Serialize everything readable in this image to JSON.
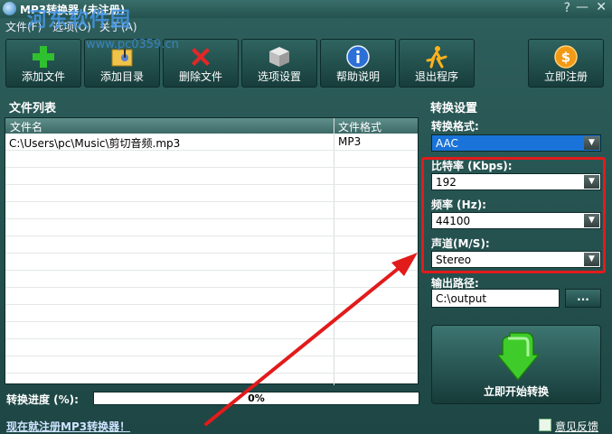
{
  "window": {
    "title": "MP3转换器 (未注册)",
    "controls": {
      "help": "?",
      "minimize": "—",
      "close": "✕"
    }
  },
  "menu": {
    "items": [
      {
        "label": "文件(F)"
      },
      {
        "label": "选项(O)"
      },
      {
        "label": "关于(A)"
      }
    ]
  },
  "watermark": {
    "text": "河东软件园",
    "url": "www.pc0359.cn"
  },
  "toolbar": {
    "buttons": [
      {
        "label": "添加文件",
        "icon": "add-file-icon"
      },
      {
        "label": "添加目录",
        "icon": "add-folder-icon"
      },
      {
        "label": "删除文件",
        "icon": "delete-icon"
      },
      {
        "label": "选项设置",
        "icon": "settings-cube-icon"
      },
      {
        "label": "帮助说明",
        "icon": "info-icon"
      },
      {
        "label": "退出程序",
        "icon": "exit-runner-icon"
      },
      {
        "label": "立即注册",
        "icon": "dollar-coin-icon"
      }
    ]
  },
  "filelist": {
    "title": "文件列表",
    "columns": [
      "文件名",
      "文件格式"
    ],
    "rows": [
      {
        "name": "C:\\Users\\pc\\Music\\剪切音频.mp3",
        "format": "MP3"
      }
    ]
  },
  "progress": {
    "label": "转换进度 (%):",
    "value": 0,
    "text": "0%"
  },
  "settings": {
    "title": "转换设置",
    "format": {
      "label": "转换格式:",
      "value": "AAC"
    },
    "bitrate": {
      "label": "比特率 (Kbps):",
      "value": "192"
    },
    "frequency": {
      "label": "频率 (Hz):",
      "value": "44100"
    },
    "channel": {
      "label": "声道(M/S):",
      "value": "Stereo"
    },
    "output": {
      "label": "输出路径:",
      "value": "C:\\output",
      "browse": "..."
    },
    "start": {
      "label": "立即开始转换"
    }
  },
  "footer": {
    "register_link": "现在就注册MP3转换器！",
    "feedback": "意见反馈"
  },
  "colors": {
    "accent_red": "#e21b1b",
    "selection_blue": "#1a73d9",
    "progress_green": "#3b8f3b",
    "panel_teal": "#2e5f5c"
  }
}
